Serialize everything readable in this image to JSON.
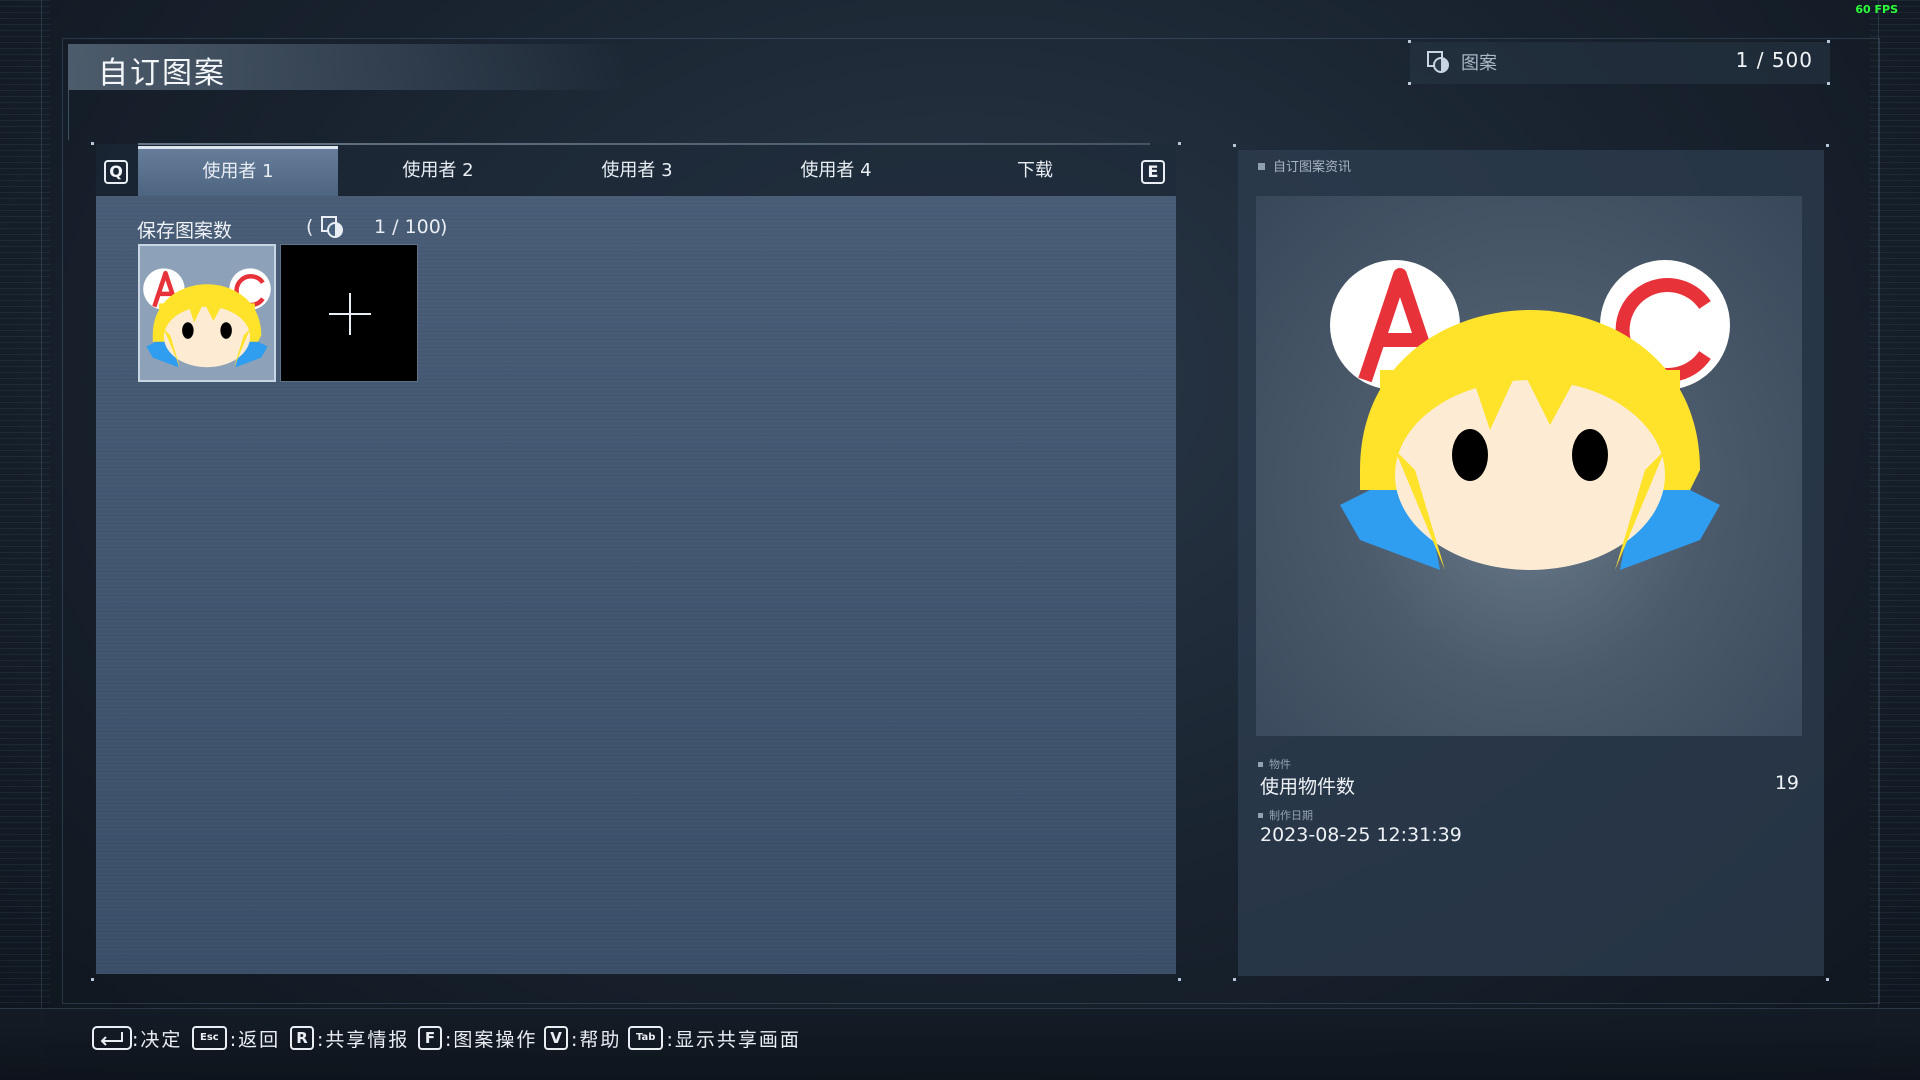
{
  "fps": "60 FPS",
  "page_title": "自订图案",
  "emblem_counter": {
    "label": "图案",
    "value": "1 / 500",
    "icon": "emblem-icon"
  },
  "tabs": {
    "left_key": "Q",
    "right_key": "E",
    "items": [
      {
        "label": "使用者 1",
        "active": true
      },
      {
        "label": "使用者 2",
        "active": false
      },
      {
        "label": "使用者 3",
        "active": false
      },
      {
        "label": "使用者 4",
        "active": false
      },
      {
        "label": "下载",
        "active": false
      }
    ]
  },
  "saved": {
    "label": "保存图案数",
    "paren_open": "(",
    "count": "1 / 100",
    "paren_close": ")",
    "icon": "emblem-icon"
  },
  "thumbnails": [
    {
      "type": "emblem",
      "selected": true,
      "icon": "chibi-emblem"
    },
    {
      "type": "add",
      "icon": "plus-icon"
    }
  ],
  "info": {
    "header": "自订图案资讯",
    "parts_category": "物件",
    "parts_label": "使用物件数",
    "parts_value": "19",
    "date_category": "制作日期",
    "date_value": "2023-08-25 12:31:39"
  },
  "hints": [
    {
      "key": "enter-icon",
      "label": ":决定"
    },
    {
      "key": "Esc",
      "label": ":返回"
    },
    {
      "key": "R",
      "label": ":共享情报"
    },
    {
      "key": "F",
      "label": ":图案操作"
    },
    {
      "key": "V",
      "label": ":帮助"
    },
    {
      "key": "Tab",
      "label": ":显示共享画面"
    }
  ],
  "colors": {
    "panel": "#3f5470",
    "background": "#18222e",
    "fps": "#2bff3a",
    "emblem_hair": "#ffe22a",
    "emblem_face": "#fdecd3",
    "emblem_ribbon": "#2f9df0",
    "emblem_letters": "#e8323a"
  }
}
